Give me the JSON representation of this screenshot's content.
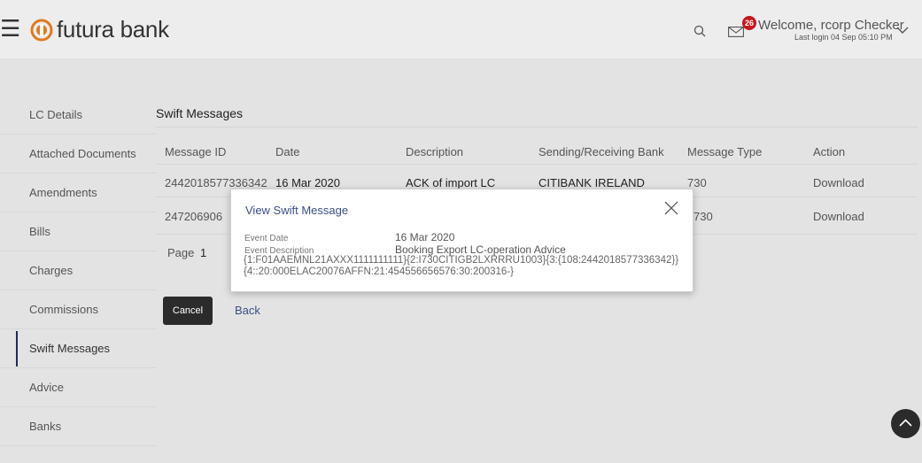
{
  "header": {
    "brand": "futura bank",
    "notification_count": "26",
    "welcome": "Welcome, rcorp Checker",
    "last_login": "Last login 04 Sep 05:10 PM"
  },
  "sidebar": {
    "items": [
      {
        "label": "LC Details"
      },
      {
        "label": "Attached Documents"
      },
      {
        "label": "Amendments"
      },
      {
        "label": "Bills"
      },
      {
        "label": "Charges"
      },
      {
        "label": "Commissions"
      },
      {
        "label": "Swift Messages"
      },
      {
        "label": "Advice"
      },
      {
        "label": "Banks"
      }
    ]
  },
  "main": {
    "title": "Swift Messages",
    "columns": [
      "Message ID",
      "Date",
      "Description",
      "Sending/Receiving Bank",
      "Message Type",
      "Action"
    ],
    "rows": [
      {
        "id": "2442018577336342",
        "date": "16 Mar 2020",
        "desc": "ACK of import LC",
        "bank": "CITIBANK IRELAND",
        "type": "730",
        "action": "Download"
      },
      {
        "id": "247206906",
        "date": "",
        "desc": "",
        "bank": "",
        "type": "730",
        "action": "Download"
      }
    ],
    "page_label": "Page",
    "page_number": "1",
    "cancel_label": "Cancel",
    "back_label": "Back"
  },
  "modal": {
    "title": "View Swift Message",
    "event_date_label": "Event Date",
    "event_date": "16 Mar 2020",
    "event_desc_label": "Event Description",
    "event_desc": "Booking Export LC-operation Advice",
    "message": "{1:F01AAEMNL21AXXX1111111111}{2:I730CITIGB2LXRRRU1003}{3:{108:2442018577336342}}{4::20:000ELAC20076AFFN:21:454556656576:30:200316-}"
  },
  "colors": {
    "brand_accent": "#e07a1f",
    "badge": "#c8161d",
    "active_bar": "#1f2a59",
    "link": "#3a4f86"
  }
}
